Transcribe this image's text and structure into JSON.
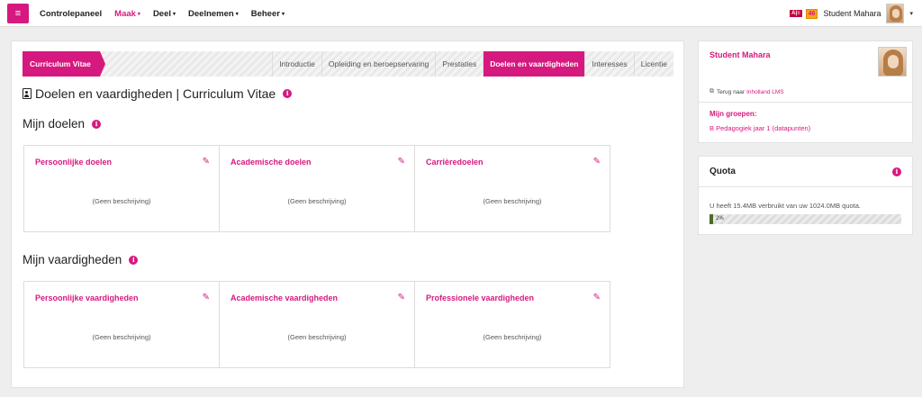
{
  "nav": {
    "menu_glyph": "≡",
    "items": [
      {
        "label": "Controlepaneel"
      },
      {
        "label": "Maak",
        "caret": "▾"
      },
      {
        "label": "Deel",
        "caret": "▾"
      },
      {
        "label": "Deelnemen",
        "caret": "▾"
      },
      {
        "label": "Beheer",
        "caret": "▾"
      }
    ],
    "active_item": "Maak",
    "ar_badge": "A|≡",
    "notification_count": "46",
    "user_name": "Student Mahara",
    "user_caret": "▾"
  },
  "tabs": {
    "section_label": "Curriculum Vitae",
    "items": [
      "Introductie",
      "Opleiding en beroepservaring",
      "Prestaties",
      "Doelen en vaardigheden",
      "Interesses",
      "Licentie"
    ],
    "active": "Doelen en vaardigheden"
  },
  "page_title": "Doelen en vaardigheden | Curriculum Vitae",
  "goals": {
    "heading": "Mijn doelen",
    "cards": [
      {
        "title": "Persoonlijke doelen",
        "desc": "(Geen beschrijving)"
      },
      {
        "title": "Academische doelen",
        "desc": "(Geen beschrijving)"
      },
      {
        "title": "Carrièredoelen",
        "desc": "(Geen beschrijving)"
      }
    ]
  },
  "skills": {
    "heading": "Mijn vaardigheden",
    "cards": [
      {
        "title": "Persoonlijke vaardigheden",
        "desc": "(Geen beschrijving)"
      },
      {
        "title": "Academische vaardigheden",
        "desc": "(Geen beschrijving)"
      },
      {
        "title": "Professionele vaardigheden",
        "desc": "(Geen beschrijving)"
      }
    ]
  },
  "sidebar": {
    "profile_name": "Student Mahara",
    "back_prefix": "Terug naar",
    "back_link": "Inholland LMS",
    "groups_label": "Mijn groepen:",
    "group": "B Pedagogiek jaar 1 (datapunten)"
  },
  "quota": {
    "title": "Quota",
    "text": "U heeft 15.4MB verbruikt van uw 1024.0MB quota.",
    "percent_label": "2%",
    "fraction_used": 0.02
  },
  "colors": {
    "accent": "#d6197f",
    "quota_fill": "#4d6b2c"
  },
  "icons": {
    "info": "i",
    "edit": "✎",
    "external": "⧉"
  }
}
